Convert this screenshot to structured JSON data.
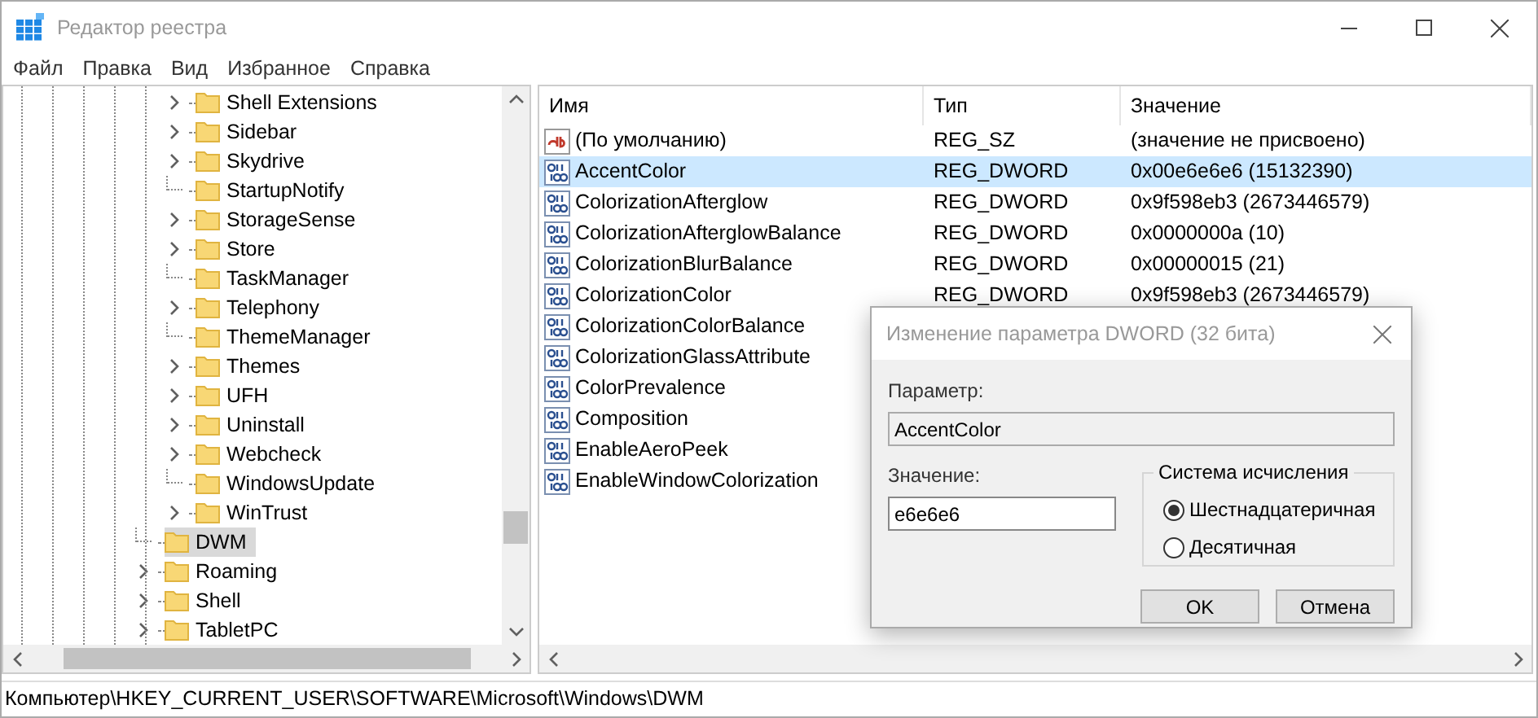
{
  "window": {
    "title": "Редактор реестра"
  },
  "menu": [
    "Файл",
    "Правка",
    "Вид",
    "Избранное",
    "Справка"
  ],
  "tree": {
    "nested_items": [
      {
        "label": "Shell Extensions",
        "expandable": true,
        "selected": false
      },
      {
        "label": "Sidebar",
        "expandable": true,
        "selected": false
      },
      {
        "label": "Skydrive",
        "expandable": true,
        "selected": false
      },
      {
        "label": "StartupNotify",
        "expandable": false,
        "selected": false
      },
      {
        "label": "StorageSense",
        "expandable": true,
        "selected": false
      },
      {
        "label": "Store",
        "expandable": true,
        "selected": false
      },
      {
        "label": "TaskManager",
        "expandable": false,
        "selected": false
      },
      {
        "label": "Telephony",
        "expandable": true,
        "selected": false
      },
      {
        "label": "ThemeManager",
        "expandable": false,
        "selected": false
      },
      {
        "label": "Themes",
        "expandable": true,
        "selected": false
      },
      {
        "label": "UFH",
        "expandable": true,
        "selected": false
      },
      {
        "label": "Uninstall",
        "expandable": true,
        "selected": false
      },
      {
        "label": "Webcheck",
        "expandable": true,
        "selected": false
      },
      {
        "label": "WindowsUpdate",
        "expandable": false,
        "selected": false
      },
      {
        "label": "WinTrust",
        "expandable": true,
        "selected": false
      }
    ],
    "items": [
      {
        "label": "DWM",
        "expandable": false,
        "selected": true
      },
      {
        "label": "Roaming",
        "expandable": true,
        "selected": false
      },
      {
        "label": "Shell",
        "expandable": true,
        "selected": false
      },
      {
        "label": "TabletPC",
        "expandable": true,
        "selected": false
      }
    ]
  },
  "table": {
    "columns": [
      "Имя",
      "Тип",
      "Значение"
    ],
    "rows": [
      {
        "kind": "string",
        "name": "(По умолчанию)",
        "type": "REG_SZ",
        "value": "(значение не присвоено)",
        "selected": false
      },
      {
        "kind": "dword",
        "name": "AccentColor",
        "type": "REG_DWORD",
        "value": "0x00e6e6e6 (15132390)",
        "selected": true
      },
      {
        "kind": "dword",
        "name": "ColorizationAfterglow",
        "type": "REG_DWORD",
        "value": "0x9f598eb3 (2673446579)",
        "selected": false
      },
      {
        "kind": "dword",
        "name": "ColorizationAfterglowBalance",
        "type": "REG_DWORD",
        "value": "0x0000000a (10)",
        "selected": false
      },
      {
        "kind": "dword",
        "name": "ColorizationBlurBalance",
        "type": "REG_DWORD",
        "value": "0x00000015 (21)",
        "selected": false
      },
      {
        "kind": "dword",
        "name": "ColorizationColor",
        "type": "REG_DWORD",
        "value": "0x9f598eb3 (2673446579)",
        "selected": false
      },
      {
        "kind": "dword",
        "name": "ColorizationColorBalance",
        "selected": false
      },
      {
        "kind": "dword",
        "name": "ColorizationGlassAttribute",
        "selected": false
      },
      {
        "kind": "dword",
        "name": "ColorPrevalence",
        "selected": false
      },
      {
        "kind": "dword",
        "name": "Composition",
        "selected": false
      },
      {
        "kind": "dword",
        "name": "EnableAeroPeek",
        "selected": false
      },
      {
        "kind": "dword",
        "name": "EnableWindowColorization",
        "selected": false
      }
    ]
  },
  "dialog": {
    "title": "Изменение параметра DWORD (32 бита)",
    "param_label": "Параметр:",
    "param_value": "AccentColor",
    "value_label": "Значение:",
    "value": "e6e6e6",
    "base_group": "Система исчисления",
    "radios": [
      {
        "label": "Шестнадцатеричная",
        "selected": true
      },
      {
        "label": "Десятичная",
        "selected": false
      }
    ],
    "buttons": [
      "OK",
      "Отмена"
    ]
  },
  "status_bar": "Компьютер\\HKEY_CURRENT_USER\\SOFTWARE\\Microsoft\\Windows\\DWM"
}
